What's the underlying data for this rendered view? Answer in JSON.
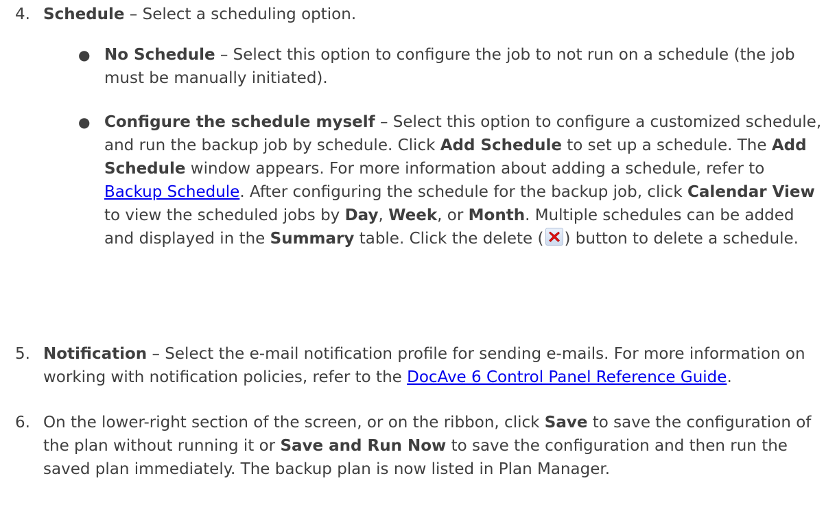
{
  "item4": {
    "number": "4.",
    "title": "Schedule",
    "text": " – Select a scheduling option.",
    "bullets": {
      "no_schedule": {
        "title": "No Schedule",
        "text": " – Select this option to configure the job to not run on a schedule (the job must be manually initiated)."
      },
      "configure": {
        "title": "Configure the schedule myself",
        "t1": " – Select this option to configure a customized schedule, and run the backup job by schedule. Click ",
        "add_schedule_1": "Add Schedule",
        "t2": " to set up a schedule. The ",
        "add_schedule_2": "Add Schedule",
        "t3": " window appears. For more information about adding a schedule, refer to ",
        "link_backup_schedule": "Backup Schedule",
        "t4": ". After configuring the schedule for the backup job, click ",
        "calendar_view": "Calendar View",
        "t5": " to view the scheduled jobs by ",
        "day": "Day",
        "comma1": ", ",
        "week": "Week",
        "comma_or": ", or ",
        "month": "Month",
        "t6": ". Multiple schedules can be added and displayed in the ",
        "summary": "Summary",
        "t7": " table. Click the delete (",
        "t8": ") button to delete a schedule."
      }
    }
  },
  "item5": {
    "number": "5.",
    "title": "Notification",
    "text": " – Select the e-mail notification profile for sending e-mails. For more information on working with notification policies, refer to the ",
    "link_guide": "DocAve 6 Control Panel Reference Guide",
    "end": "."
  },
  "item6": {
    "number": "6.",
    "t1": "On the lower-right section of the screen, or on the ribbon, click ",
    "save": "Save",
    "t2": " to save the configuration of the plan without running it or ",
    "save_and_run": "Save and Run Now",
    "t3": " to save the configuration and then run the saved plan immediately. The backup plan is now listed in Plan Manager."
  },
  "icons": {
    "delete": "delete-x-icon",
    "delete_color": "#e01010"
  }
}
